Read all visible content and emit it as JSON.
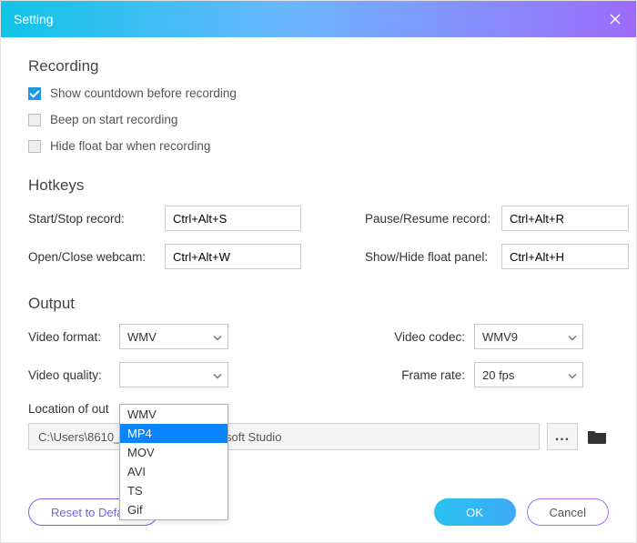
{
  "window": {
    "title": "Setting"
  },
  "recording": {
    "title": "Recording",
    "opts": [
      {
        "label": "Show countdown before recording",
        "checked": true
      },
      {
        "label": "Beep on start recording",
        "checked": false
      },
      {
        "label": "Hide float bar when recording",
        "checked": false
      }
    ]
  },
  "hotkeys": {
    "title": "Hotkeys",
    "start_stop_label": "Start/Stop record:",
    "start_stop_value": "Ctrl+Alt+S",
    "pause_resume_label": "Pause/Resume record:",
    "pause_resume_value": "Ctrl+Alt+R",
    "webcam_label": "Open/Close webcam:",
    "webcam_value": "Ctrl+Alt+W",
    "panel_label": "Show/Hide float panel:",
    "panel_value": "Ctrl+Alt+H"
  },
  "output": {
    "title": "Output",
    "format_label": "Video format:",
    "format_value": "WMV",
    "codec_label": "Video codec:",
    "codec_value": "WMV9",
    "quality_label": "Video quality:",
    "quality_value": "",
    "framerate_label": "Frame rate:",
    "framerate_value": "20 fps",
    "location_label": "Location of out",
    "location_value": "C:\\Users\\8610_\\____________\\__esoft Studio",
    "browse_label": "...",
    "format_options": [
      "WMV",
      "MP4",
      "MOV",
      "AVI",
      "TS",
      "Gif"
    ],
    "format_selected_index": 1
  },
  "footer": {
    "reset": "Reset to Default",
    "ok": "OK",
    "cancel": "Cancel"
  }
}
